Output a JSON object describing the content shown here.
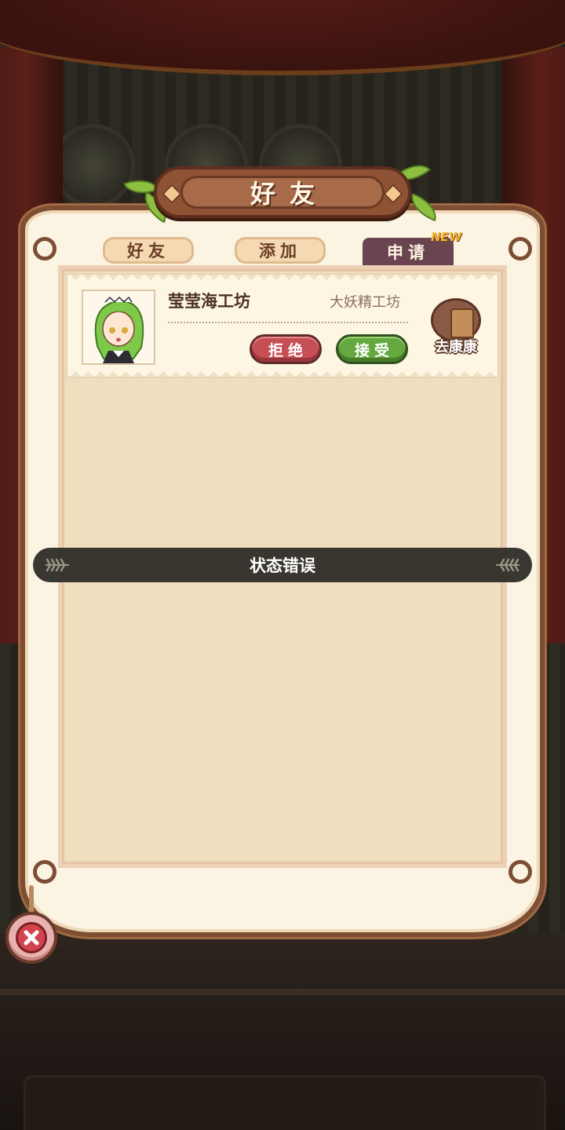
{
  "title": "好友",
  "tabs": [
    {
      "label": "好友",
      "active": false
    },
    {
      "label": "添加",
      "active": false
    },
    {
      "label": "申请",
      "active": true
    }
  ],
  "new_badge": "NEW",
  "requests": [
    {
      "name": "莹莹海工坊",
      "workshop": "大妖精工坊",
      "reject_label": "拒绝",
      "accept_label": "接受",
      "visit_label": "去康康"
    }
  ],
  "toast": "状态错误",
  "colors": {
    "panel_bg": "#fbf4e2",
    "panel_border": "#7d4e33",
    "active_tab": "#6b4452",
    "reject": "#c64f56",
    "accept": "#65a83f",
    "toast_bg": "#2e2c28"
  },
  "icons": {
    "close": "close-icon",
    "visit": "door-icon"
  }
}
